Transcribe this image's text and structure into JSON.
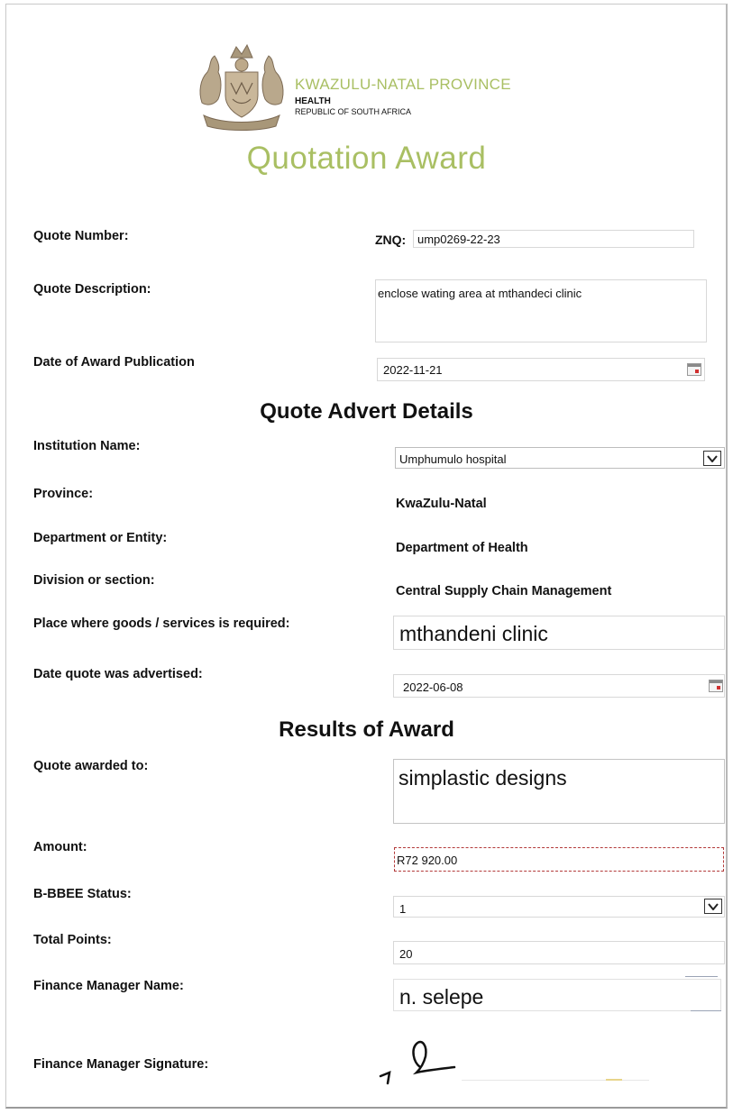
{
  "header": {
    "province_title": "KWAZULU-NATAL PROVINCE",
    "department": "HEALTH",
    "country": "REPUBLIC OF SOUTH AFRICA",
    "document_title": "Quotation Award",
    "brand_color": "#a9bf63"
  },
  "award": {
    "quote_number_label": "Quote Number:",
    "quote_prefix": "ZNQ:",
    "quote_number": "ump0269-22-23",
    "description_label": "Quote Description:",
    "description": "enclose wating area at mthandeci clinic",
    "publication_label": "Date of Award Publication",
    "publication_date": "2022-11-21"
  },
  "advert": {
    "heading": "Quote Advert Details",
    "institution_label": "Institution Name:",
    "institution": "Umphumulo hospital",
    "province_label": "Province:",
    "province": "KwaZulu-Natal",
    "department_label": "Department or Entity:",
    "department": "Department of Health",
    "division_label": "Division or section:",
    "division": "Central Supply Chain Management",
    "place_label": "Place where goods /  services is required:",
    "place": "mthandeni clinic",
    "advertised_label": "Date quote was advertised:",
    "advertised_date": "2022-06-08"
  },
  "results": {
    "heading": "Results of Award",
    "awarded_label": "Quote awarded to:",
    "awarded_to": "simplastic designs",
    "amount_label": "Amount:",
    "amount": "R72 920.00",
    "bbbee_label": "B-BBEE Status:",
    "bbbee": "1",
    "points_label": "Total Points:",
    "points": "20",
    "manager_label": "Finance Manager Name:",
    "manager_name": "n. selepe",
    "signature_label": "Finance Manager Signature:"
  }
}
